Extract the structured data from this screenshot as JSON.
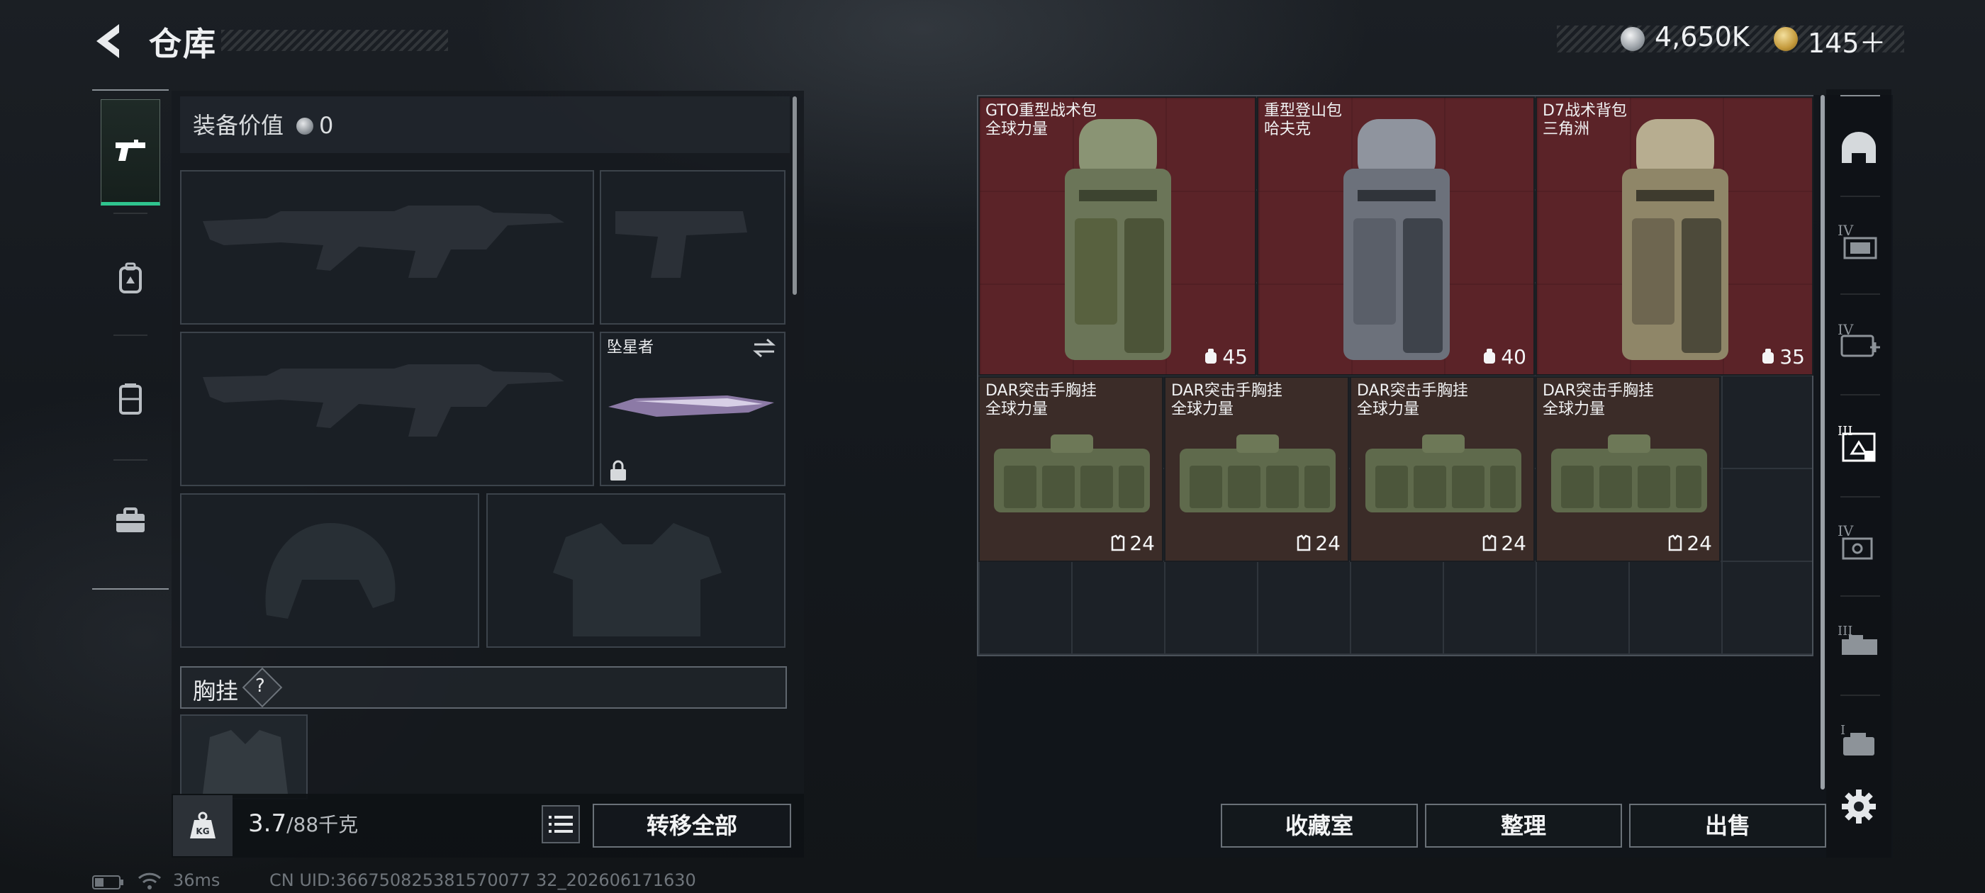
{
  "header": {
    "title": "仓库",
    "currency_silver": "4,650K",
    "currency_gold": "145＋"
  },
  "left_rail": {
    "tabs": [
      {
        "icon": "pistol-icon",
        "active": true
      },
      {
        "icon": "backpack-icon",
        "active": false
      },
      {
        "icon": "chest-rig-icon",
        "active": false
      },
      {
        "icon": "toolbox-icon",
        "active": false
      }
    ]
  },
  "loadout": {
    "equip_value_label": "装备价值",
    "equip_value": "0",
    "melee_name": "坠星者",
    "vest_label": "胸挂",
    "vest_help": "?",
    "weight_current": "3.7",
    "weight_max": "/88千克",
    "kg_badge": "KG",
    "transfer_all": "转移全部"
  },
  "stash": {
    "backpacks": [
      {
        "name": "GTO重型战术包",
        "faction": "全球力量",
        "capacity": "45",
        "color": "#8a9474"
      },
      {
        "name": "重型登山包",
        "faction": "哈夫克",
        "capacity": "40",
        "color": "#8a8f98"
      },
      {
        "name": "D7战术背包",
        "faction": "三角洲",
        "capacity": "35",
        "color": "#b2a78a"
      }
    ],
    "rigs": [
      {
        "name": "DAR突击手胸挂",
        "faction": "全球力量",
        "capacity": "24"
      },
      {
        "name": "DAR突击手胸挂",
        "faction": "全球力量",
        "capacity": "24"
      },
      {
        "name": "DAR突击手胸挂",
        "faction": "全球力量",
        "capacity": "24"
      },
      {
        "name": "DAR突击手胸挂",
        "faction": "全球力量",
        "capacity": "24"
      }
    ],
    "collection_btn": "收藏室",
    "sort_btn": "整理",
    "sell_btn": "出售"
  },
  "right_sidebar": {
    "icons": [
      "helmet-filter-icon",
      "armor-lvl-4-icon",
      "medkit-lvl-4-icon",
      "rig-lvl-3-icon",
      "storage-lvl-4-icon",
      "case-lvl-3-icon",
      "box-lvl-1-icon",
      "settings-icon"
    ]
  },
  "status_bar": {
    "ping": "36ms",
    "uid": "CN UID:366750825381570077 32_202606171630"
  }
}
